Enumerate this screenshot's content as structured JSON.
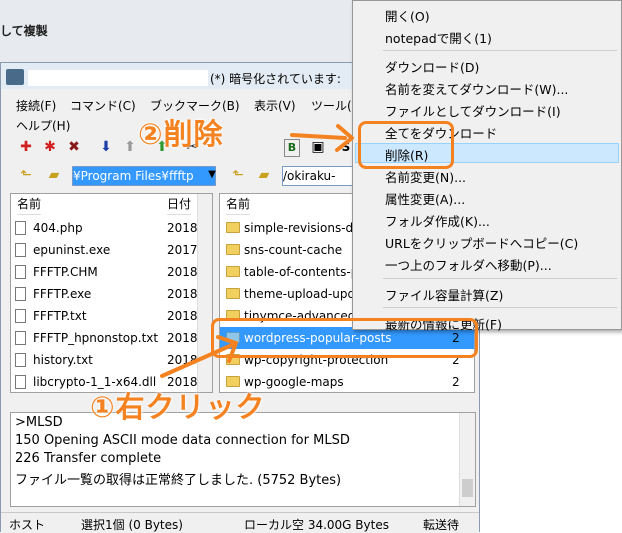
{
  "background_title": "して複製",
  "window": {
    "title_text": "(*) 暗号化されています: ",
    "menu": [
      "接続(F)",
      "コマンド(C)",
      "ブックマーク(B)",
      "表示(V)",
      "ツール("
    ],
    "menu2": "ヘルプ(H)"
  },
  "toolbar": {
    "icons": [
      "connect-icon",
      "disconnect-icon",
      "cancel-icon",
      "download-icon",
      "upload-icon",
      "upload-green-icon"
    ]
  },
  "local": {
    "path": "¥Program Files¥ffftp",
    "columns": {
      "name": "名前",
      "date": "日付"
    },
    "files": [
      {
        "name": "404.php",
        "date": "2018"
      },
      {
        "name": "epuninst.exe",
        "date": "2017,"
      },
      {
        "name": "FFFTP.CHM",
        "date": "2018"
      },
      {
        "name": "FFFTP.exe",
        "date": "2018"
      },
      {
        "name": "FFFTP.txt",
        "date": "2018"
      },
      {
        "name": "FFFTP_hpnonstop.txt",
        "date": "2018"
      },
      {
        "name": "history.txt",
        "date": "2018"
      },
      {
        "name": "libcrypto-1_1-x64.dll",
        "date": "2018"
      }
    ]
  },
  "remote": {
    "path": "/okiraku-",
    "columns": {
      "name": "名前"
    },
    "folders": [
      {
        "name": "simple-revisions-de",
        "date": "2"
      },
      {
        "name": "sns-count-cache",
        "date": "2"
      },
      {
        "name": "table-of-contents-p",
        "date": "2"
      },
      {
        "name": "theme-upload-upd",
        "date": "2"
      },
      {
        "name": "tinymce-advanced",
        "date": "2"
      },
      {
        "name": "wordpress-popular-posts",
        "date": "2"
      },
      {
        "name": "wp-copyright-protection",
        "date": "2"
      },
      {
        "name": "wp-google-maps",
        "date": "2"
      }
    ]
  },
  "log": [
    ">MLSD",
    "150 Opening ASCII mode data connection for MLSD",
    "226 Transfer complete",
    "ファイル一覧の取得は正常終了しました. (5752 Bytes)"
  ],
  "status": {
    "host": "ホスト",
    "selection": "選択1個 (0 Bytes)",
    "local_free": "ローカル空 34.00G Bytes",
    "transfer": "転送待"
  },
  "context_menu": {
    "items": [
      "開く(O)",
      "notepadで開く(1)",
      "ダウンロード(D)",
      "名前を変えてダウンロード(W)...",
      "ファイルとしてダウンロード(I)",
      "全てをダウンロード",
      "削除(R)",
      "名前変更(N)...",
      "属性変更(A)...",
      "フォルダ作成(K)...",
      "URLをクリップボードへコピー(C)",
      "一つ上のフォルダへ移動(P)...",
      "ファイル容量計算(Z)",
      "最新の情報に更新(F)"
    ]
  },
  "annotations": {
    "delete": "②削除",
    "right_click": "①右クリック"
  },
  "colors": {
    "accent": "#f58220",
    "selection": "#3399ff",
    "highlight": "#cce8ff"
  }
}
